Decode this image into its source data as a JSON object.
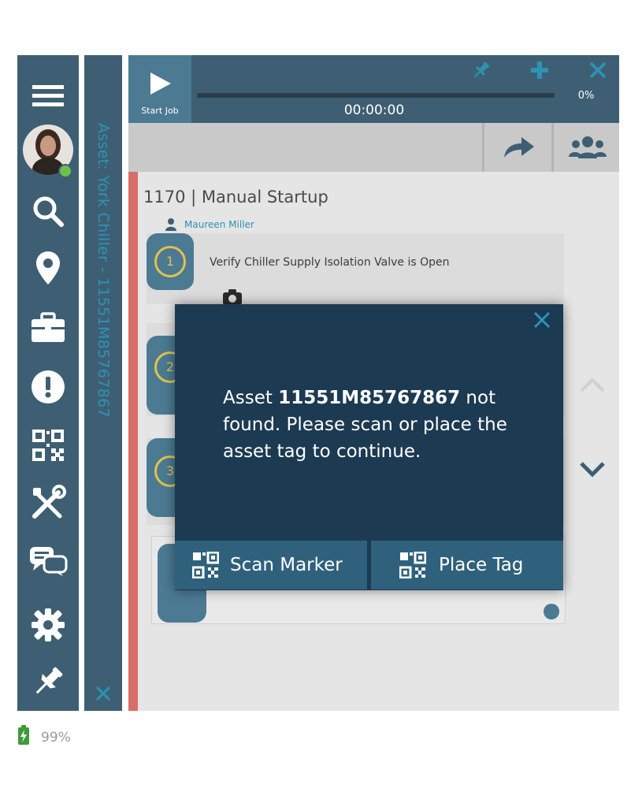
{
  "app": {
    "start_job_label": "Start Job",
    "timer": "00:00:00",
    "progress_percent": "0%",
    "asset_sidebar_title": "Asset: York Chiller - 11551M85767867",
    "job_title": "1170 | Manual Startup",
    "assignee": "Maureen Miller",
    "steps": [
      {
        "number": "1",
        "text": "Verify Chiller Supply Isolation Valve is Open"
      },
      {
        "number": "2",
        "text": ""
      },
      {
        "number": "3",
        "text": ""
      }
    ],
    "battery": "99%"
  },
  "nav": {
    "items": [
      "menu-icon",
      "avatar",
      "search-icon",
      "location-icon",
      "toolbox-icon",
      "alert-icon",
      "qr-code-icon",
      "tools-icon",
      "chat-icon",
      "settings-icon",
      "pin-icon"
    ]
  },
  "modal": {
    "message_prefix": "Asset ",
    "asset_id": "11551M85767867",
    "message_suffix": " not found. Please scan or place the asset tag to continue.",
    "scan_label": "Scan Marker",
    "place_label": "Place Tag"
  },
  "colors": {
    "nav_bg": "#3e5f73",
    "accent": "#2c93b4",
    "modal_bg": "#1c3a51",
    "modal_button": "#2f617d",
    "alert_strip": "#d96d6a"
  }
}
